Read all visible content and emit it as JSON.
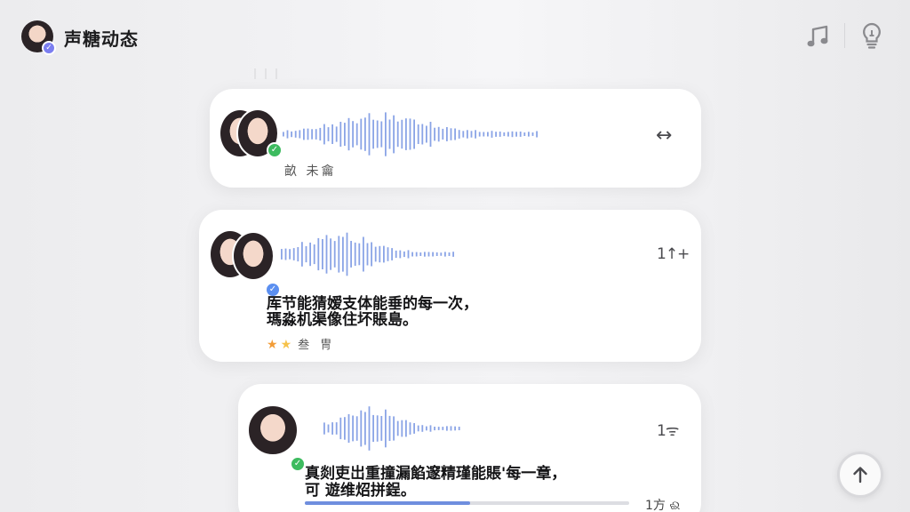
{
  "header": {
    "title": "声糖动态",
    "avatar_icon": "user-avatar-icon",
    "music_icon": "music-note-icon",
    "bulb_icon": "lightbulb-icon"
  },
  "colors": {
    "waveform": "#8aa4e6",
    "verified_green": "#3dbb5f",
    "verified_blue": "#5b8ff0",
    "star": "#f29c36",
    "progress": "#6f8ede"
  },
  "background_ghost_text": "ווו",
  "posts": [
    {
      "caption": "畝 未龠",
      "action": "↔",
      "verified": "✓"
    },
    {
      "action": "1↑+",
      "verified": "✓",
      "line1": "厍节能猜嫒支体能垂的每一次，",
      "line2": "瑪淼机渠像住坏賬島。",
      "stars": 2,
      "stars_label": "叁 冑"
    },
    {
      "action": "1ᯤ",
      "verified": "✓",
      "line1": "真剡吏岀重撞漏餡邃精瑾能賬'每一章，",
      "line2": "可 遊维炤拼鋥。",
      "progress": 0.51,
      "progress_label": "1方 ଈ"
    }
  ],
  "scroll_top_icon": "arrow-up-icon"
}
